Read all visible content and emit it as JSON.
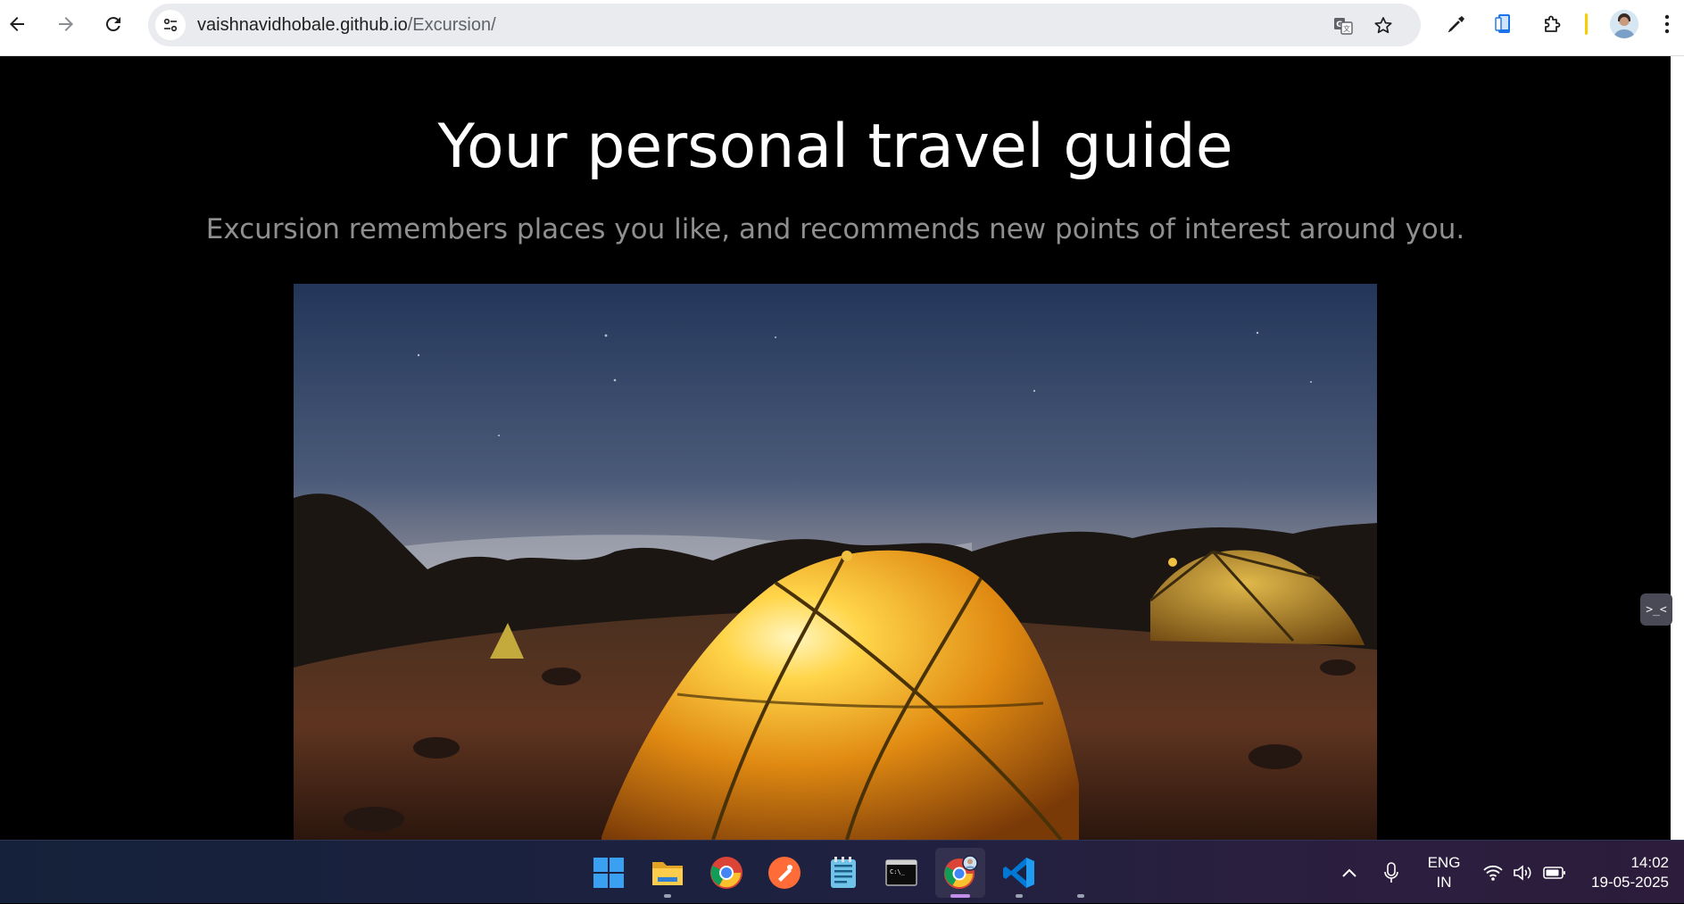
{
  "browser": {
    "url_host": "vaishnavidhobale.github.io",
    "url_path": "/Excursion/",
    "nav": {
      "back_icon": "arrow-left-icon",
      "forward_icon": "arrow-right-icon",
      "reload_icon": "reload-icon"
    },
    "omnibox_icons": [
      "site-info-icon",
      "translate-icon",
      "bookmark-star-icon"
    ],
    "toolbar_icons": [
      "eyedropper-icon",
      "phone-screen-icon",
      "extensions-puzzle-icon",
      "profile-avatar",
      "menu-kebab-icon"
    ]
  },
  "page": {
    "title": "Your personal travel guide",
    "subtitle": "Excursion remembers places you like, and recommends new points of interest around you.",
    "hero_image": "night-camping-tents-photo",
    "devtools_handle_label": ">_<"
  },
  "taskbar": {
    "apps": [
      {
        "name": "start-button",
        "icon": "windows-logo-icon"
      },
      {
        "name": "file-explorer",
        "icon": "folder-icon"
      },
      {
        "name": "chrome",
        "icon": "chrome-icon"
      },
      {
        "name": "postman",
        "icon": "postman-icon"
      },
      {
        "name": "notepad",
        "icon": "notepad-icon"
      },
      {
        "name": "terminal",
        "icon": "terminal-icon"
      },
      {
        "name": "chrome-profile",
        "icon": "chrome-profile-icon",
        "active": true
      },
      {
        "name": "vscode",
        "icon": "vscode-icon"
      }
    ],
    "tray": {
      "language_line1": "ENG",
      "language_line2": "IN",
      "time": "14:02",
      "date": "19-05-2025"
    }
  },
  "colors": {
    "page_bg": "#000000",
    "title": "#ffffff",
    "subtitle": "#8f8f8f",
    "omnibox_bg": "#e9ebee",
    "taskbar_bg": "#1b2140"
  }
}
